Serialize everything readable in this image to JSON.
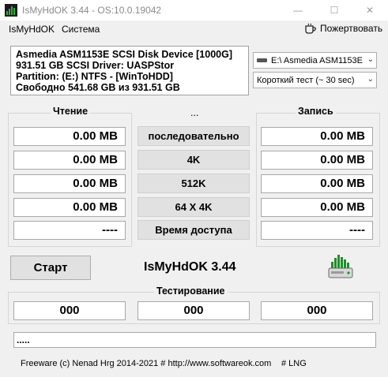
{
  "window": {
    "title": "IsMyHdOK 3.44 - OS:10.0.19042",
    "minimize_glyph": "—",
    "maximize_glyph": "☐",
    "close_glyph": "✕"
  },
  "menu": {
    "file": "IsMyHdOK",
    "system": "Система",
    "donate": "Пожертвовать",
    "donate_icon": "coffee-cup-icon"
  },
  "info": {
    "line1": "Asmedia ASM1153E SCSI Disk Device [1000G]",
    "line2": "931.51 GB  SCSI Driver: UASPStor",
    "line3": "Partition: (E:) NTFS - [WinToHDD]",
    "line4": "Свободно 541.68 GB из 931.51 GB"
  },
  "selects": {
    "drive": "E:\\ Asmedia ASM1153E",
    "test": "Короткий тест (~ 30 sec)"
  },
  "read": {
    "title": "Чтение",
    "values": [
      "0.00 MB",
      "0.00 MB",
      "0.00 MB",
      "0.00 MB",
      "----"
    ]
  },
  "middle": {
    "title": "...",
    "buttons": [
      "последовательно",
      "4K",
      "512K",
      "64 X 4K",
      "Время доступа"
    ]
  },
  "write": {
    "title": "Запись",
    "values": [
      "0.00 MB",
      "0.00 MB",
      "0.00 MB",
      "0.00 MB",
      "----"
    ]
  },
  "controls": {
    "start": "Старт",
    "app_name": "IsMyHdOK 3.44"
  },
  "testing": {
    "title": "Тестирование",
    "values": [
      "000",
      "000",
      "000"
    ]
  },
  "status": {
    "text": "....."
  },
  "footer": {
    "copyright": "Freeware (c) Nenad Hrg 2014-2021 # http://www.softwareok.com",
    "lng": "# LNG"
  },
  "colors": {
    "window_bg": "#f0f0f0",
    "box_bg": "#ffffff",
    "button_bg": "#e1e1e1",
    "icon_green": "#1f8f2a"
  }
}
